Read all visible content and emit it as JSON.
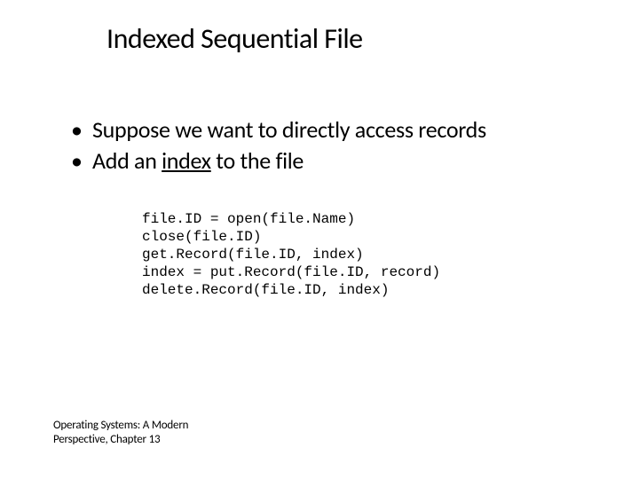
{
  "title": "Indexed Sequential File",
  "bullets": [
    {
      "pre": "Suppose we want to directly access records",
      "u": "",
      "post": ""
    },
    {
      "pre": "Add an ",
      "u": "index",
      "post": " to the file"
    }
  ],
  "code": "file.ID = open(file.Name)\nclose(file.ID)\nget.Record(file.ID, index)\nindex = put.Record(file.ID, record)\ndelete.Record(file.ID, index)",
  "footer": {
    "line1": "Operating Systems: A Modern",
    "line2": "Perspective, Chapter 13"
  }
}
